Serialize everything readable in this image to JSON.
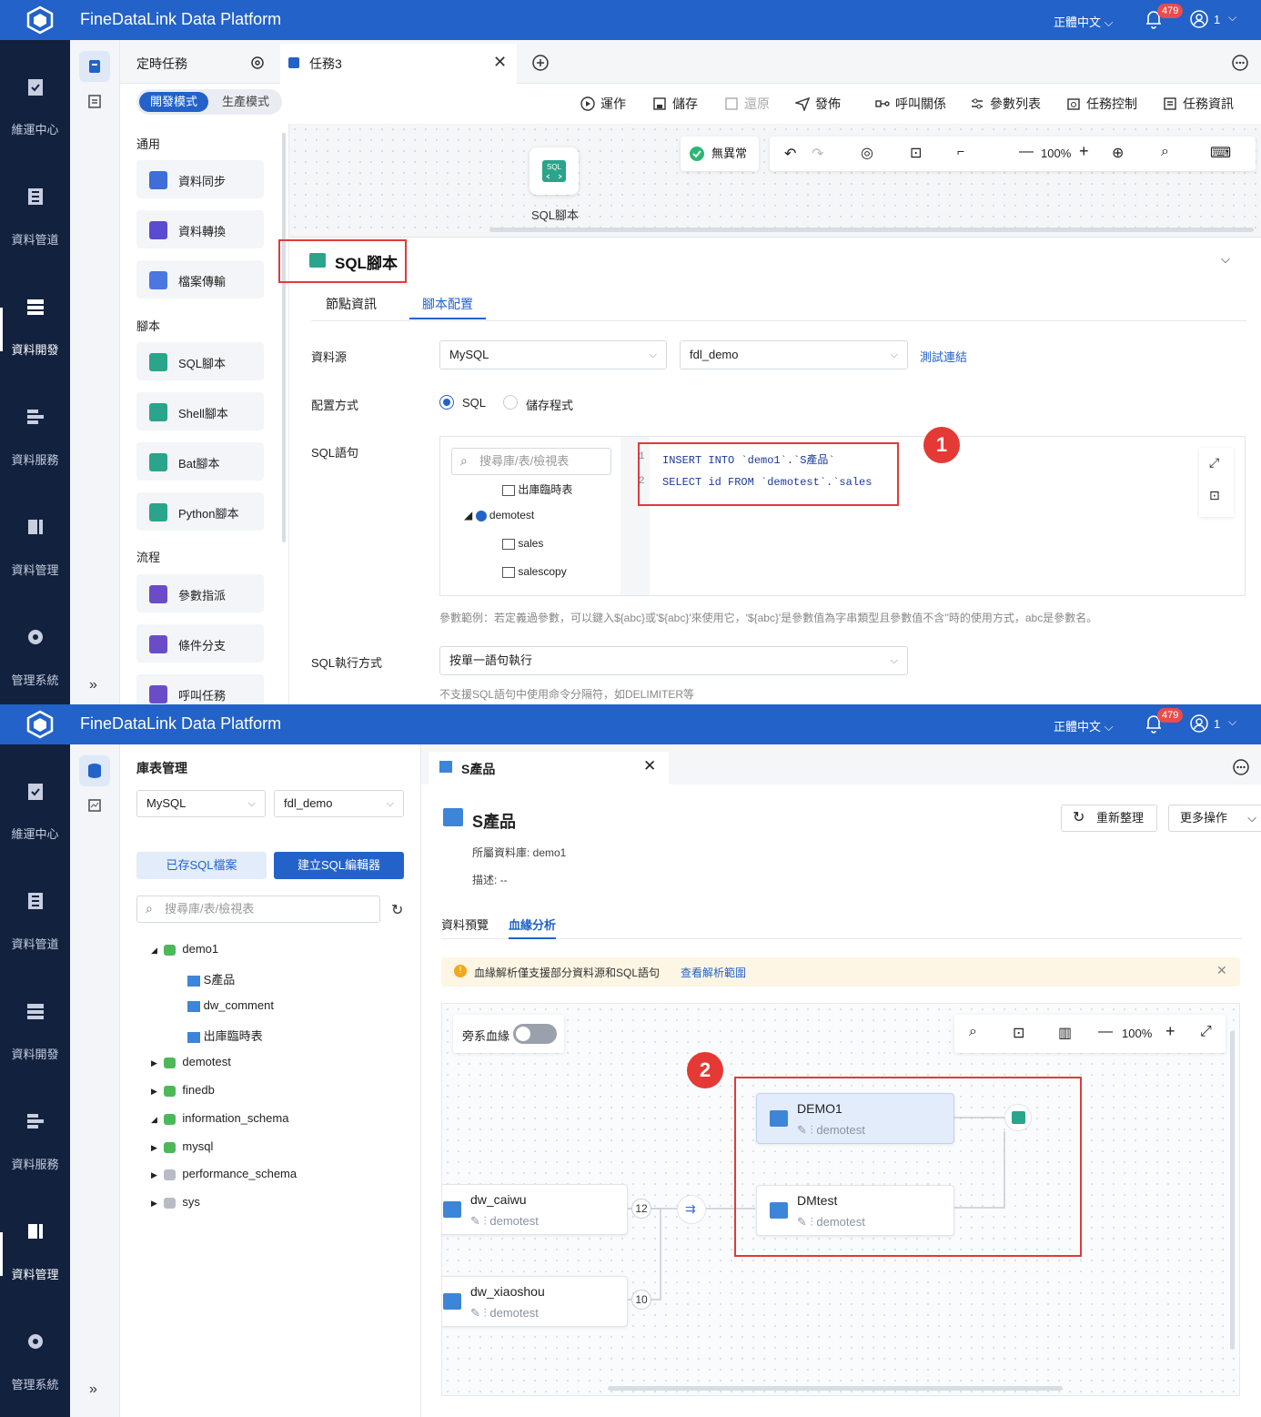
{
  "app": {
    "title": "FineDataLink Data Platform",
    "language": "正體中文",
    "notifications": "479",
    "user": "1"
  },
  "nav": {
    "items": [
      "維運中心",
      "資料管道",
      "資料開發",
      "資料服務",
      "資料管理",
      "管理系統"
    ],
    "collapse": "»"
  },
  "top": {
    "tabs": {
      "scheduled": "定時任務",
      "task": "任務3"
    },
    "mode": {
      "dev": "開發模式",
      "prod": "生產模式"
    },
    "toolbar": {
      "run": "運作",
      "save": "儲存",
      "restore": "還原",
      "publish": "發佈",
      "call": "呼叫關係",
      "params": "參數列表",
      "control": "任務控制",
      "info": "任務資訊"
    },
    "palette": {
      "general": "通用",
      "sync": "資料同步",
      "transform": "資料轉換",
      "file": "檔案傳輸",
      "script": "腳本",
      "sql": "SQL腳本",
      "shell": "Shell腳本",
      "bat": "Bat腳本",
      "python": "Python腳本",
      "flow": "流程",
      "assign": "參數指派",
      "branch": "條件分支",
      "call": "呼叫任務"
    },
    "canvas": {
      "status": "無異常",
      "zoom": "100%",
      "node_label": "SQL腳本"
    },
    "panel": {
      "title": "SQL腳本",
      "tabs": [
        "節點資訊",
        "腳本配置"
      ],
      "datasource_label": "資料源",
      "datasource": "MySQL",
      "database": "fdl_demo",
      "test_link": "測試連結",
      "config_label": "配置方式",
      "opt_sql": "SQL",
      "opt_proc": "儲存程式",
      "sql_label": "SQL語句",
      "search_placeholder": "搜尋庫/表/檢視表",
      "tree": [
        "出庫臨時表",
        "demotest",
        "sales",
        "salescopy"
      ],
      "code_line1": "INSERT INTO `demo1`.`S產品`",
      "code_line2": "SELECT id FROM `demotest`.`sales",
      "line_nums": [
        "1",
        "2"
      ],
      "hint": "參數範例：若定義過參數，可以鍵入${abc}或'${abc}'來使用它，'${abc}'是參數值為字串類型且參數值不含''時的使用方式，abc是參數名。",
      "exec_label": "SQL執行方式",
      "exec_value": "按單一語句執行",
      "exec_hint": "不支援SQL語句中使用命令分隔符，如DELIMITER等",
      "marker": "1"
    }
  },
  "bottom": {
    "lib_title": "庫表管理",
    "datasource": "MySQL",
    "database": "fdl_demo",
    "saved_btn": "已存SQL檔案",
    "create_btn": "建立SQL編輯器",
    "search_placeholder": "搜尋庫/表/檢視表",
    "tree": {
      "demo1": "demo1",
      "t1": "S產品",
      "t2": "dw_comment",
      "t3": "出庫臨時表",
      "demotest": "demotest",
      "finedb": "finedb",
      "info": "information_schema",
      "mysql": "mysql",
      "perf": "performance_schema",
      "sys": "sys"
    },
    "tab": "S產品",
    "table_title": "S產品",
    "refresh": "重新整理",
    "more": "更多操作",
    "db_label": "所屬資料庫: demo1",
    "desc_label": "描述: --",
    "subtabs": [
      "資料預覽",
      "血緣分析"
    ],
    "notice": "血緣解析僅支援部分資料源和SQL語句",
    "notice_link": "查看解析範圍",
    "side_lineage": "旁系血緣",
    "zoom": "100%",
    "nodes": {
      "demo1": {
        "name": "DEMO1",
        "db": "demotest"
      },
      "dmtest": {
        "name": "DMtest",
        "db": "demotest"
      },
      "caiwu": {
        "name": "dw_caiwu",
        "db": "demotest"
      },
      "xiaoshou": {
        "name": "dw_xiaoshou",
        "db": "demotest"
      }
    },
    "counts": {
      "caiwu": "12",
      "xiaoshou": "10"
    },
    "marker": "2"
  },
  "colors": {
    "primary": "#2262c9",
    "nav_bg": "#12213e",
    "accent_red": "#e03a3a",
    "sql_green": "#2aa48a"
  }
}
